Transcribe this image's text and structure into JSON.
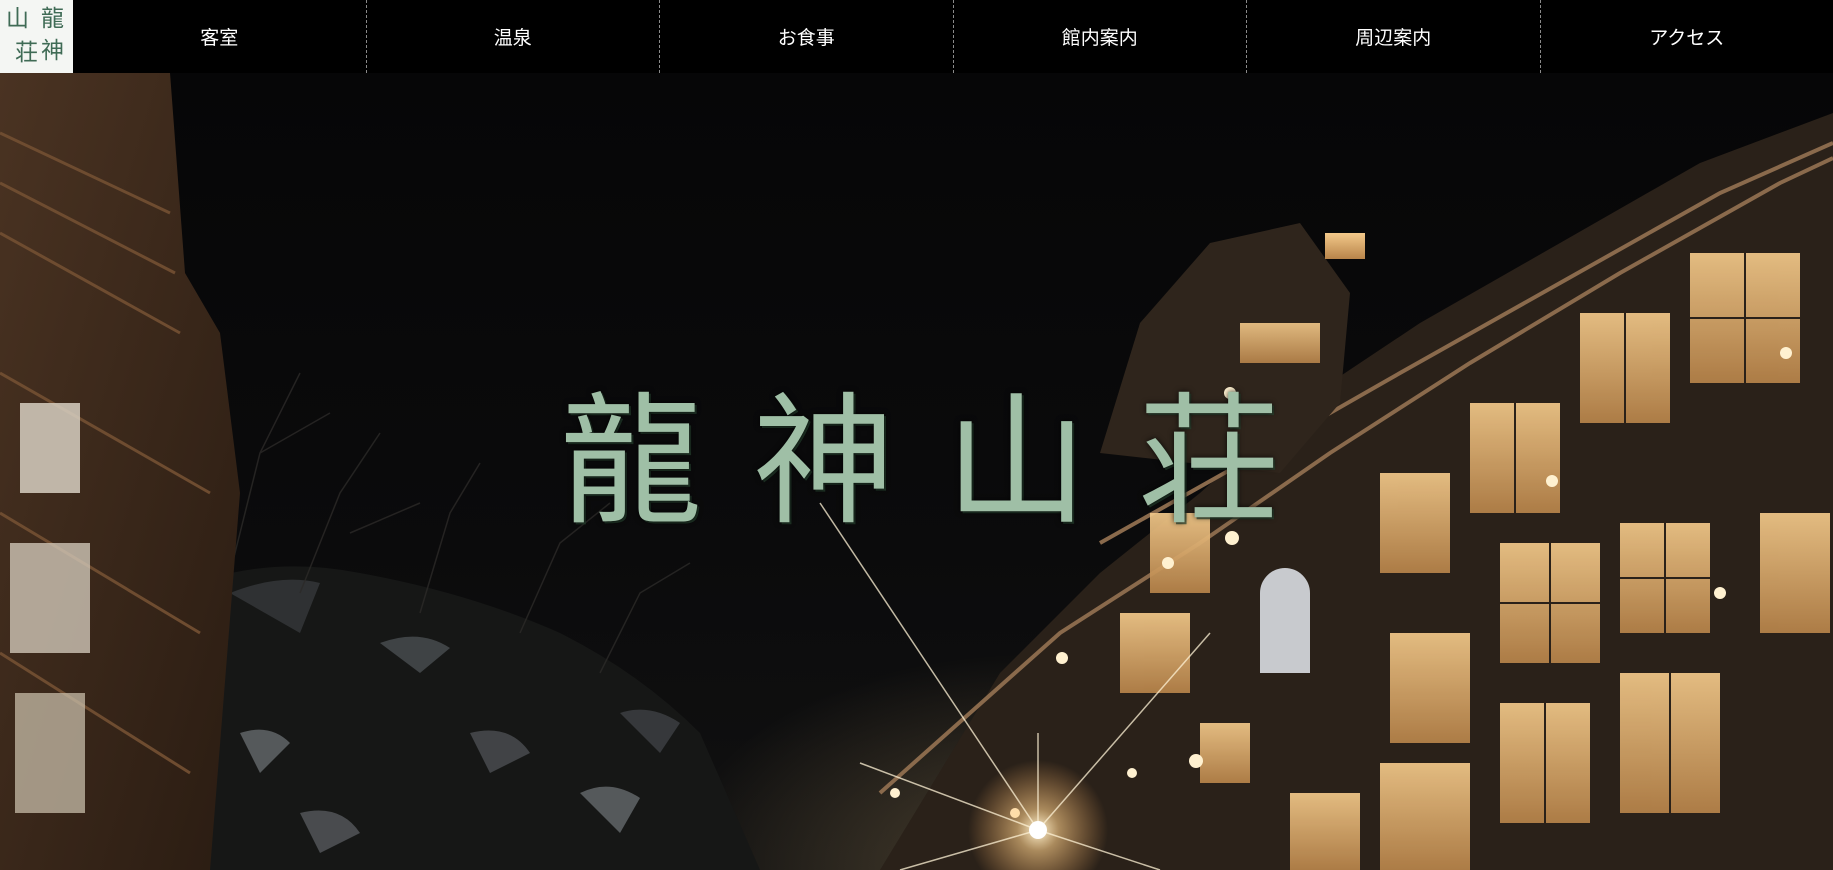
{
  "logo": {
    "chars": [
      "龍",
      "神",
      "山",
      "荘"
    ]
  },
  "nav": {
    "items": [
      {
        "label": "客室"
      },
      {
        "label": "温泉"
      },
      {
        "label": "お食事"
      },
      {
        "label": "館内案内"
      },
      {
        "label": "周辺案内"
      },
      {
        "label": "アクセス"
      }
    ]
  },
  "hero": {
    "title_chars": [
      "龍",
      "神",
      "山",
      "荘"
    ]
  },
  "colors": {
    "nav_background": "#000000",
    "nav_text": "#ffffff",
    "title_color": "#9fbfa6",
    "logo_background": "#f4f6f3",
    "logo_text": "#3f6b55"
  }
}
